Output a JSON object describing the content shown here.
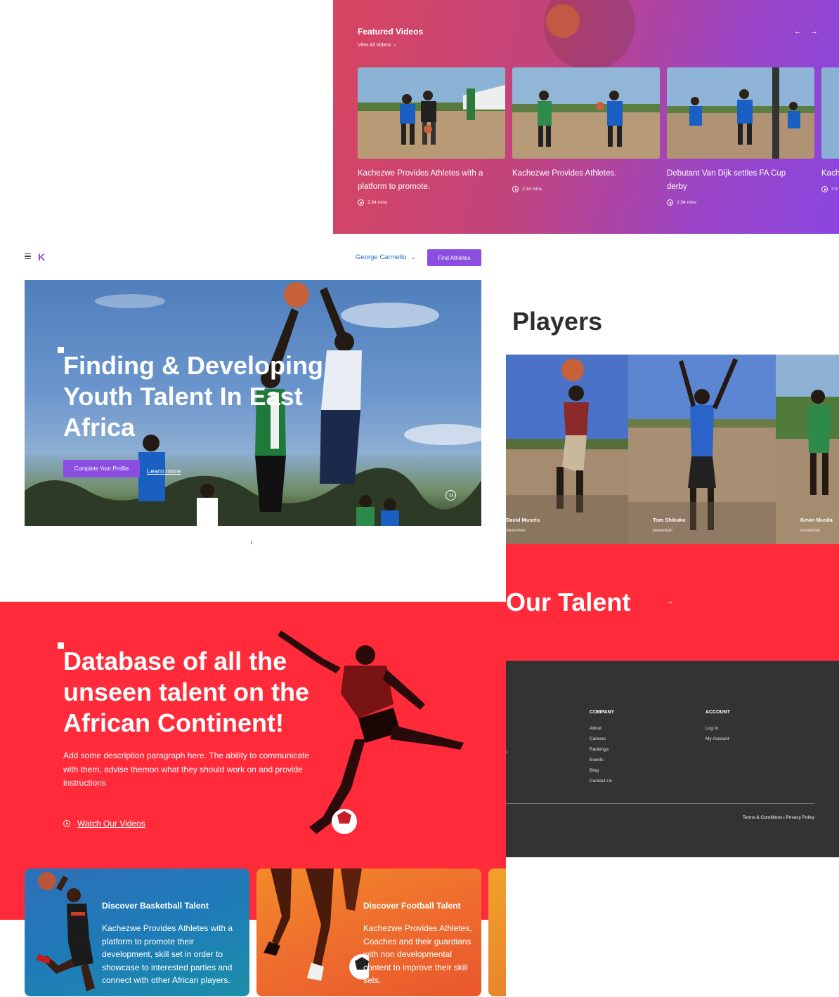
{
  "featured": {
    "title": "Featured Videos",
    "view_all": "View All Videos",
    "videos": [
      {
        "title": "Kachezwe Provides Athletes with a platform to promote.",
        "duration": "2:34 mins"
      },
      {
        "title": "Kachezwe Provides Athletes.",
        "duration": "2:34 mins"
      },
      {
        "title": "Debutant Van Dijk settles FA Cup derby",
        "duration": "2:34 mins"
      },
      {
        "title": "Kach",
        "duration": "2:3"
      }
    ]
  },
  "nav": {
    "logo": "K",
    "user": "George Carmello",
    "find_button": "Find Athletes"
  },
  "hero": {
    "title": "Finding & Developing Youth Talent In East Africa",
    "cta": "Complete Your Profile",
    "learn_more": "Learn more"
  },
  "players": {
    "heading": "Players",
    "items": [
      {
        "name": "David Muselu",
        "sport": "Basketball"
      },
      {
        "name": "Tom Shikuku",
        "sport": "Basketball"
      },
      {
        "name": "Kevin Musila",
        "sport": "Basketball"
      }
    ]
  },
  "talent": {
    "heading": "Our Talent"
  },
  "footer": {
    "company": {
      "heading": "COMPANY",
      "links": [
        "About",
        "Careers",
        "Rankings",
        "Events",
        "Blog",
        "Contact Us"
      ]
    },
    "account": {
      "heading": "ACCOUNT",
      "links": [
        "Log In",
        "My Account"
      ]
    },
    "legal": "Terms & Conditions | Privacy Policy",
    "fragment": "s"
  },
  "database": {
    "title": "Database of all the unseen talent on the African Continent!",
    "description": "Add some description paragraph here. The ability to communicate with them, advise themon what they should work on and provide instructions",
    "watch": "Watch Our Videos"
  },
  "discover": [
    {
      "title": "Discover Basketball Talent",
      "text": "Kachezwe Provides Athletes with a platform to promote their development, skill set in order to showcase to interested parties and connect with other African players."
    },
    {
      "title": "Discover Football Talent",
      "text": "Kachezwe Provides Athletes, Coaches and their guardians with non developmental content to improve their skill sets."
    }
  ],
  "colors": {
    "brand_purple": "#8b4ee0",
    "talent_red": "#ff2b3a",
    "footer_dark": "#333333",
    "link_blue": "#2b6bd0"
  }
}
